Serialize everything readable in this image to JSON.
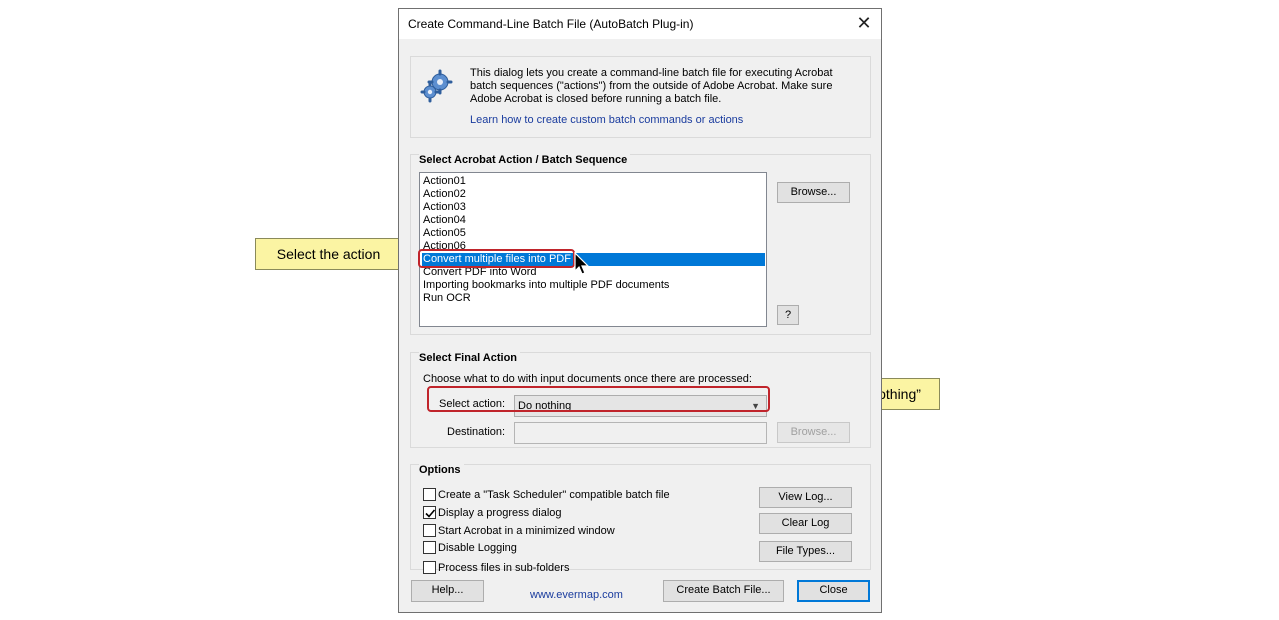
{
  "dialog": {
    "title": "Create Command-Line Batch File (AutoBatch Plug-in)",
    "close_glyph": "✕"
  },
  "info": {
    "line1": "This dialog lets you create a command-line batch file for executing Acrobat",
    "line2": "batch sequences (\"actions\") from the outside of Adobe Acrobat. Make sure",
    "line3": "Adobe Acrobat is closed before running a batch file.",
    "link": "Learn how to create custom batch commands or actions",
    "icon": "gears-icon"
  },
  "action_group": {
    "title": "Select Acrobat Action / Batch Sequence",
    "items": [
      "Action01",
      "Action02",
      "Action03",
      "Action04",
      "Action05",
      "Action06",
      "Convert multiple files into PDF",
      "Convert PDF into Word",
      "Importing bookmarks into multiple PDF documents",
      "Run OCR"
    ],
    "selected_index": 6,
    "browse_label": "Browse...",
    "help_label": "?"
  },
  "final_group": {
    "title": "Select Final Action",
    "description": "Choose what to do with input documents once there are processed:",
    "select_label": "Select action:",
    "select_value": "Do nothing",
    "destination_label": "Destination:",
    "destination_value": "",
    "browse_label": "Browse..."
  },
  "options_group": {
    "title": "Options",
    "checkboxes": [
      {
        "label": "Create a \"Task Scheduler\" compatible batch file",
        "checked": false
      },
      {
        "label": "Display a progress dialog",
        "checked": true
      },
      {
        "label": "Start Acrobat in a minimized window",
        "checked": false
      },
      {
        "label": "Disable Logging",
        "checked": false
      },
      {
        "label": "Process files in sub-folders",
        "checked": false
      }
    ],
    "view_log_label": "View Log...",
    "clear_log_label": "Clear Log",
    "file_types_label": "File Types..."
  },
  "footer": {
    "help_label": "Help...",
    "website": "www.evermap.com",
    "create_label": "Create Batch File...",
    "close_label": "Close"
  },
  "annotations": {
    "callout_action": "Select the action",
    "callout_nothing": "Select “Do nothing”",
    "color": "#c0242b"
  }
}
